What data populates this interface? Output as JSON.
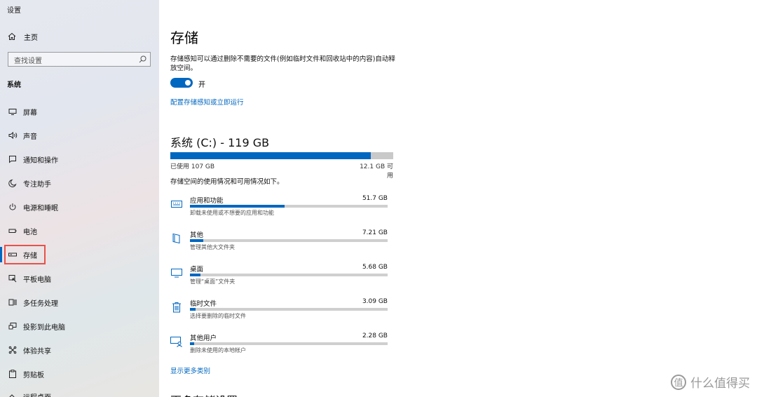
{
  "window": {
    "title": "设置"
  },
  "sidebar": {
    "home_label": "主页",
    "search_placeholder": "查找设置",
    "section_label": "系统",
    "items": [
      {
        "label": "屏幕",
        "icon": "monitor-icon"
      },
      {
        "label": "声音",
        "icon": "speaker-icon"
      },
      {
        "label": "通知和操作",
        "icon": "notification-icon"
      },
      {
        "label": "专注助手",
        "icon": "moon-icon"
      },
      {
        "label": "电源和睡眠",
        "icon": "power-icon"
      },
      {
        "label": "电池",
        "icon": "battery-icon"
      },
      {
        "label": "存储",
        "icon": "storage-icon",
        "active": true
      },
      {
        "label": "平板电脑",
        "icon": "tablet-icon"
      },
      {
        "label": "多任务处理",
        "icon": "multitask-icon"
      },
      {
        "label": "投影到此电脑",
        "icon": "project-icon"
      },
      {
        "label": "体验共享",
        "icon": "share-icon"
      },
      {
        "label": "剪贴板",
        "icon": "clipboard-icon"
      },
      {
        "label": "远程桌面",
        "icon": "remote-icon"
      }
    ]
  },
  "main": {
    "title": "存储",
    "description": "存储感知可以通过删除不需要的文件(例如临时文件和回收站中的内容)自动释放空间。",
    "toggle_label": "开",
    "toggle_on": true,
    "config_link": "配置存储感知或立即运行",
    "drive": {
      "title": "系统 (C:) - 119 GB",
      "used_label": "已使用 107 GB",
      "free_label": "12.1 GB 可用",
      "used_fraction": 0.899
    },
    "usage_description": "存储空间的使用情况和可用情况如下。",
    "categories": [
      {
        "name": "应用和功能",
        "size": "51.7 GB",
        "sub": "卸载未使用或不想要的应用和功能",
        "fraction": 0.48,
        "icon": "keyboard-icon"
      },
      {
        "name": "其他",
        "size": "7.21 GB",
        "sub": "管理其他大文件夹",
        "fraction": 0.067,
        "icon": "folder-icon"
      },
      {
        "name": "桌面",
        "size": "5.68 GB",
        "sub": "管理“桌面”文件夹",
        "fraction": 0.053,
        "icon": "desktop-icon"
      },
      {
        "name": "临时文件",
        "size": "3.09 GB",
        "sub": "选择要删除的临时文件",
        "fraction": 0.029,
        "icon": "trash-icon"
      },
      {
        "name": "其他用户",
        "size": "2.28 GB",
        "sub": "删除未使用的本地帐户",
        "fraction": 0.021,
        "icon": "user-screen-icon"
      }
    ],
    "more_link": "显示更多类别",
    "cut_heading": "更多存储设置"
  },
  "watermark": {
    "text": "什么值得买",
    "icon": "值"
  },
  "colors": {
    "accent": "#0067c0",
    "highlight_box": "#e5524a"
  }
}
